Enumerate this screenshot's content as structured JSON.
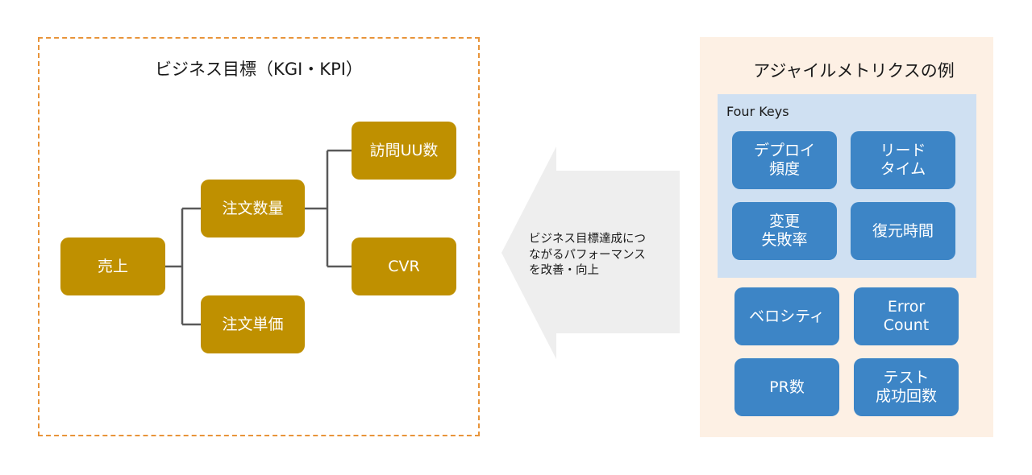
{
  "business_goals": {
    "title": "ビジネス目標（KGI・KPI）",
    "nodes": {
      "sales": "売上",
      "order_quantity": "注文数量",
      "order_unit_price": "注文単価",
      "visitor_uu": "訪問UU数",
      "cvr": "CVR"
    },
    "colors": {
      "node": "#bf9000",
      "connector": "#595959",
      "frame": "#e8943a"
    }
  },
  "arrow": {
    "text_lines": [
      "ビジネス目標達成につ",
      "ながるパフォーマンス",
      "を改善・向上"
    ],
    "color": "#eeeeee",
    "direction": "left"
  },
  "agile_metrics": {
    "title": "アジャイルメトリクスの例",
    "four_keys": {
      "label": "Four Keys",
      "items": [
        {
          "line1": "デプロイ",
          "line2": "頻度"
        },
        {
          "line1": "リード",
          "line2": "タイム"
        },
        {
          "line1": "変更",
          "line2": "失敗率"
        },
        {
          "line1": "復元時間",
          "line2": ""
        }
      ]
    },
    "others": [
      {
        "line1": "ベロシティ",
        "line2": ""
      },
      {
        "line1": "Error",
        "line2": "Count"
      },
      {
        "line1": "PR数",
        "line2": ""
      },
      {
        "line1": "テスト",
        "line2": "成功回数"
      }
    ],
    "colors": {
      "panel": "#fdf0e4",
      "four_keys_panel": "#cfe0f2",
      "node": "#3d85c6"
    }
  }
}
